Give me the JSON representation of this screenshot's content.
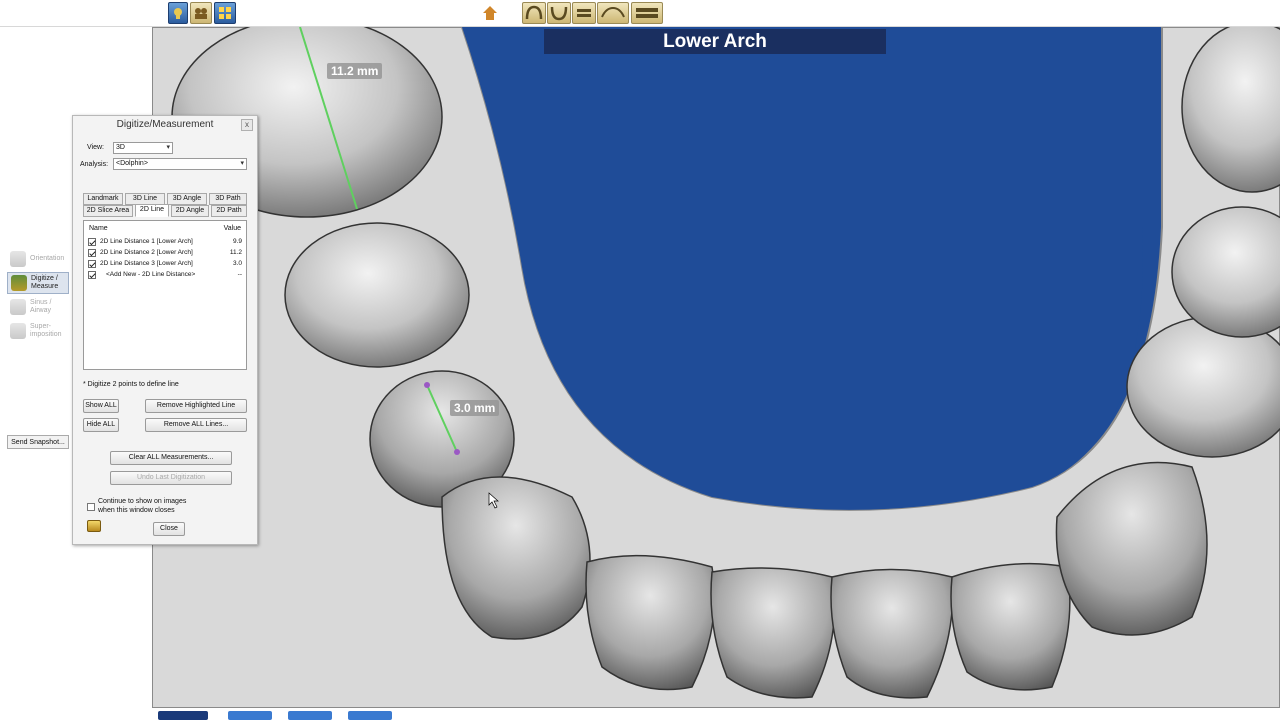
{
  "viewport": {
    "title": "Lower Arch",
    "measure_labels": [
      "11.2 mm",
      "3.0 mm"
    ]
  },
  "side_tools": [
    {
      "label": "Orientation",
      "active": false
    },
    {
      "label": "Digitize / Measure",
      "active": true
    },
    {
      "label": "Sinus / Airway",
      "active": false
    },
    {
      "label": "Super-imposition",
      "active": false
    }
  ],
  "side_snapshot_label": "Send Snapshot...",
  "dialog": {
    "title": "Digitize/Measurement",
    "close_glyph": "x",
    "view_label": "View:",
    "view_value": "3D",
    "analysis_label": "Analysis:",
    "analysis_value": "<Dolphin>",
    "tabs_row1": [
      "Landmark",
      "3D Line",
      "3D Angle",
      "3D Path"
    ],
    "tabs_row2": [
      "2D Slice Area",
      "2D Line",
      "2D Angle",
      "2D Path"
    ],
    "active_tab": "2D Line",
    "list_header_name": "Name",
    "list_header_value": "Value",
    "rows": [
      {
        "name": "2D Line Distance 1 [Lower Arch]",
        "value": "9.9",
        "checked": true
      },
      {
        "name": "2D Line Distance 2 [Lower Arch]",
        "value": "11.2",
        "checked": true
      },
      {
        "name": "2D Line Distance 3 [Lower Arch]",
        "value": "3.0",
        "checked": true
      },
      {
        "name": "<Add New - 2D Line Distance>",
        "value": "--",
        "checked": true
      }
    ],
    "hint": "* Digitize 2 points to define line",
    "show_all": "Show ALL",
    "hide_all": "Hide ALL",
    "remove_highlighted": "Remove Highlighted Line",
    "remove_all_lines": "Remove ALL Lines...",
    "clear_all": "Clear ALL Measurements...",
    "undo": "Undo Last Digitization",
    "continue_text_1": "Continue to show on images",
    "continue_text_2": "when this window closes",
    "close_button": "Close"
  },
  "colors": {
    "viewport_bg": "#1f4c98",
    "title_bar": "#1a2f60",
    "measure_line": "#5fd05f",
    "tooth_fill": "#c8c8c8",
    "gum_fill": "#dcdcdc"
  },
  "icons": [
    "tool-icon-1",
    "tool-icon-2",
    "tool-icon-3",
    "home-icon",
    "arch-view-icons",
    "cursor-icon"
  ]
}
